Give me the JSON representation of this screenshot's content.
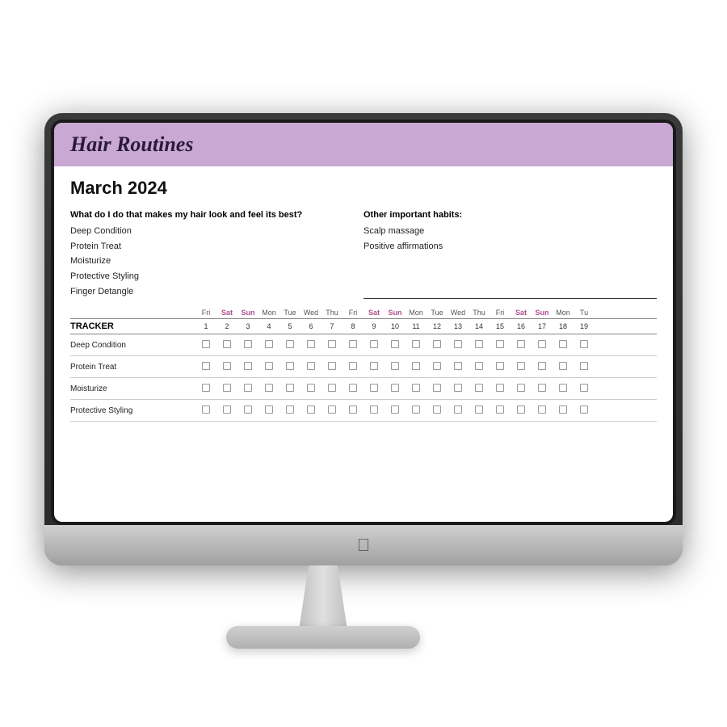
{
  "app": {
    "title": "Hair Routines"
  },
  "month": "March 2024",
  "habits_question": "What do I do that makes my hair look and feel its best?",
  "habits_left": [
    "Deep Condition",
    "Protein Treat",
    "Moisturize",
    "Protective Styling",
    "Finger Detangle"
  ],
  "other_habits_label": "Other important habits:",
  "habits_right": [
    "Scalp massage",
    "Positive affirmations"
  ],
  "tracker_label": "TRACKER",
  "tracker_rows": [
    "Deep Condition",
    "Protein Treat",
    "Moisturize",
    "Protective Styling"
  ],
  "day_names": [
    "Fri",
    "Sat",
    "Sun",
    "Mon",
    "Tue",
    "Wed",
    "Thu",
    "Fri",
    "Sat",
    "Sun",
    "Mon",
    "Tue",
    "Wed",
    "Thu",
    "Fri",
    "Sat",
    "Sun",
    "Mon",
    "Tu"
  ],
  "day_numbers": [
    1,
    2,
    3,
    4,
    5,
    6,
    7,
    8,
    9,
    10,
    11,
    12,
    13,
    14,
    15,
    16,
    17,
    18,
    19
  ],
  "weekend_indices": [
    1,
    2,
    8,
    9,
    15,
    16
  ],
  "colors": {
    "header_bg": "#c9a8d4",
    "header_title": "#2a1a3a",
    "weekend_day": "#b05090"
  }
}
